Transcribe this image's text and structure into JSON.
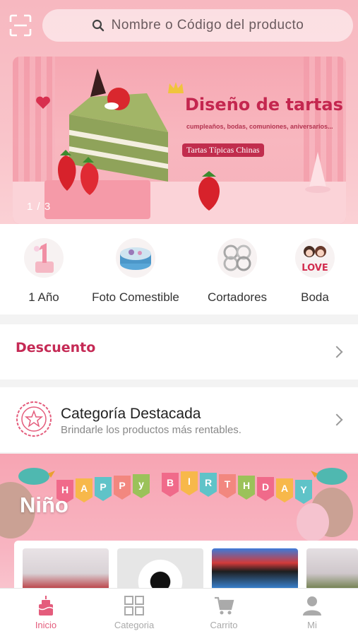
{
  "search": {
    "placeholder": "Nombre o Código del producto"
  },
  "banner": {
    "title": "Diseño de tartas",
    "subtitle": "cumpleaños, bodas, comuniones, aniversarios...",
    "tag": "Tartas Típicas Chinas",
    "pager": "1 / 3"
  },
  "categories": [
    {
      "label": "1 Año"
    },
    {
      "label": "Foto Comestible"
    },
    {
      "label": "Cortadores"
    },
    {
      "label": "Boda"
    }
  ],
  "category_icons": {
    "boda_text": "LOVE"
  },
  "discount": {
    "title": "Descuento"
  },
  "featured": {
    "title": "Categoría Destacada",
    "subtitle": "Brindarle los productos más rentables."
  },
  "promo": {
    "title": "Niño",
    "banner_letters": [
      "H",
      "A",
      "P",
      "P",
      "y",
      "B",
      "I",
      "R",
      "T",
      "H",
      "D",
      "A",
      "Y"
    ]
  },
  "nav": {
    "items": [
      {
        "label": "Inicio",
        "icon": "cake-icon"
      },
      {
        "label": "Categoria",
        "icon": "grid-icon"
      },
      {
        "label": "Carrito",
        "icon": "cart-icon"
      },
      {
        "label": "Mi",
        "icon": "user-icon"
      }
    ]
  },
  "colors": {
    "accent": "#e45c7c",
    "brand": "#c52a55"
  }
}
